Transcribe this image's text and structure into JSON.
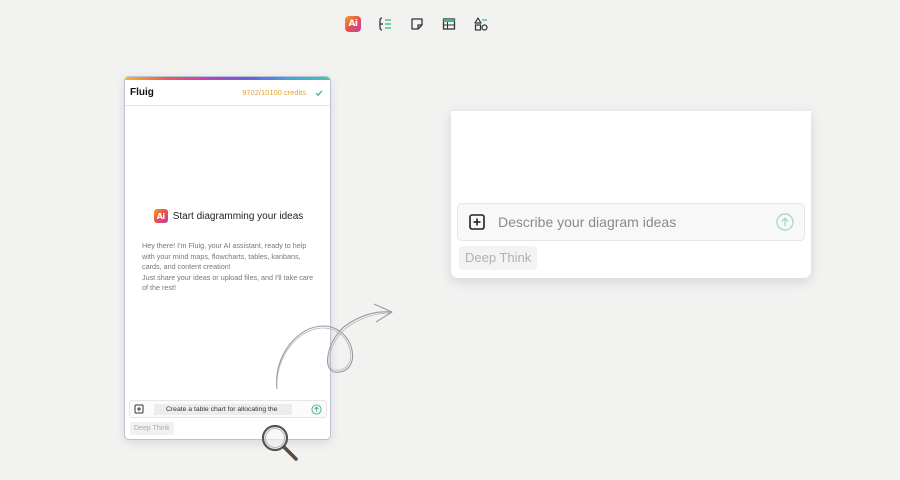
{
  "toolbar": {
    "ai_label": "Ai",
    "tools": [
      "ai-icon",
      "mindmap-icon",
      "sticky-note-icon",
      "table-icon",
      "shapes-icon"
    ]
  },
  "panel": {
    "brand": "Fluig",
    "credits": "9702/10100 credits",
    "welcome_title": "Start diagramming your ideas",
    "welcome_body_1": "Hey there! I'm Fluig, your AI assistant, ready to help with your mind maps, flowcharts, tables, kanbans, cards, and content creation!",
    "welcome_body_2": "Just share your ideas or upload files, and I'll take care of the rest!",
    "prompt_value": "Create a table chart for allocating the",
    "deep_think": "Deep Think"
  },
  "zoom": {
    "placeholder": "Describe your diagram ideas",
    "deep_think": "Deep Think"
  },
  "colors": {
    "accent_green": "#3cb487",
    "credits": "#e6a12a",
    "panel_border": "#b9c2d6"
  }
}
